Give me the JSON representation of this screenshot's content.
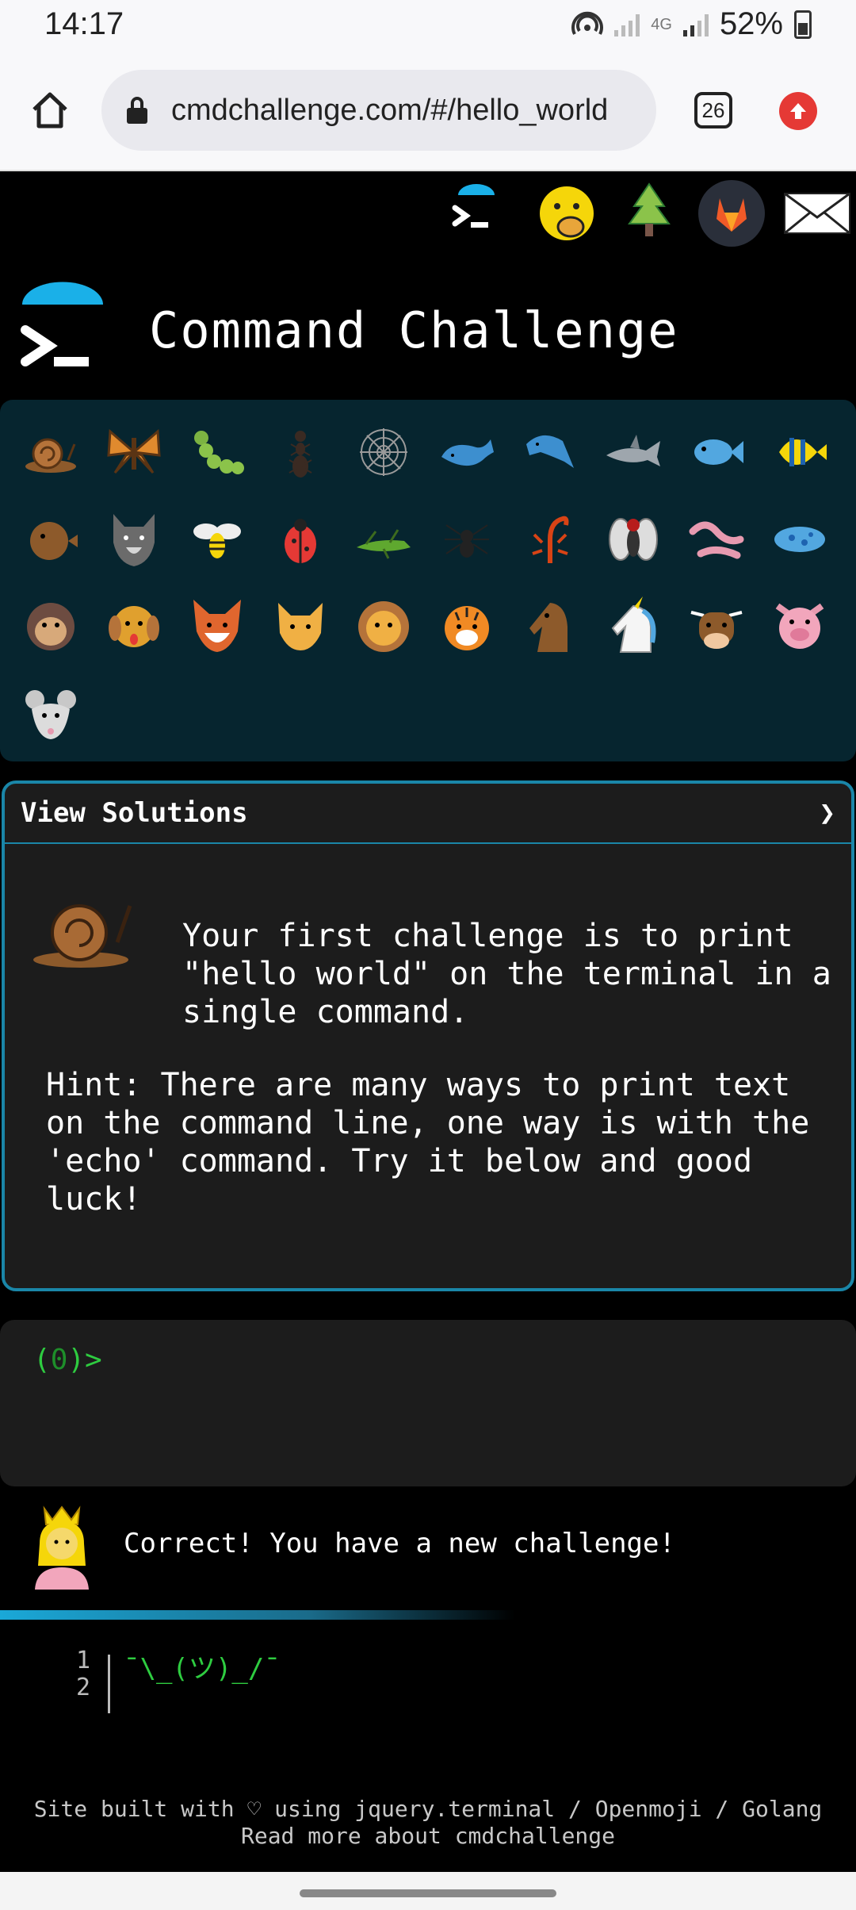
{
  "status": {
    "time": "14:17",
    "network": "4G",
    "battery": "52%"
  },
  "browser": {
    "url": "cmdchallenge.com/#/hello_world",
    "tab_count": "26"
  },
  "header": {
    "title": "Command Challenge"
  },
  "topicons": [
    "terminal-icon",
    "hand-over-mouth-icon",
    "tree-icon",
    "gitlab-icon",
    "envelope-icon"
  ],
  "grid": {
    "icons": [
      "snail",
      "butterfly",
      "caterpillar",
      "ant",
      "spiderweb",
      "whale",
      "dolphin",
      "shark",
      "fish",
      "tropical-fish",
      "blowfish",
      "wolf",
      "bee",
      "ladybug",
      "cricket",
      "spider",
      "scorpion",
      "fly",
      "worm",
      "microbe",
      "monkey",
      "dog",
      "fox",
      "cat",
      "lion",
      "tiger",
      "horse",
      "unicorn",
      "cow",
      "pig",
      "mouse"
    ]
  },
  "challenge": {
    "view_solutions": "View Solutions",
    "chevron": "❯",
    "text": "Your first challenge is to print \"hello world\" on the terminal in a single command.",
    "hint": "Hint: There are many ways to print text on the command line, one way is with the 'echo' command. Try it below and good luck!"
  },
  "terminal": {
    "prompt_open": "(",
    "count": "0",
    "prompt_close": ")>"
  },
  "message": {
    "text": "Correct! You have a new challenge!"
  },
  "code": {
    "line1": "1",
    "line2": "2",
    "shrug": "¯\\_(ツ)_/¯"
  },
  "footer": {
    "line1": "Site built with ♡ using jquery.terminal / Openmoji / Golang",
    "line2": "Read more about cmdchallenge"
  },
  "colors": {
    "accent": "#1a86a8",
    "grid_bg": "#06252f",
    "prompt_green": "#2ecc40"
  }
}
